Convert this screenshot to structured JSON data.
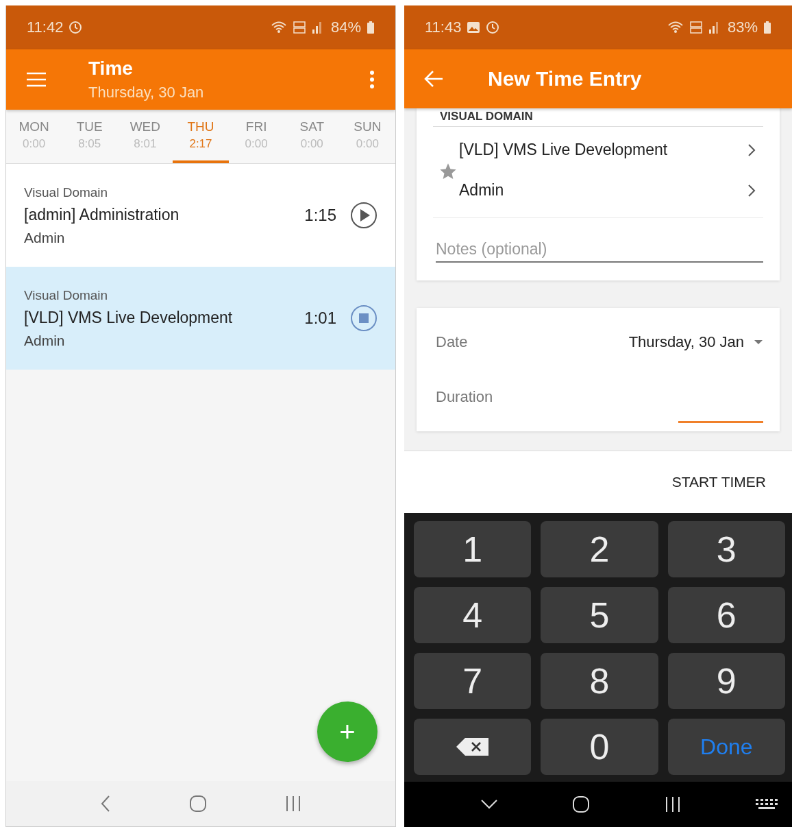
{
  "left": {
    "status_bar": {
      "time": "11:42",
      "battery": "84%"
    },
    "app_bar": {
      "title": "Time",
      "subtitle": "Thursday, 30 Jan"
    },
    "days": [
      {
        "day": "MON",
        "hours": "0:00",
        "selected": false
      },
      {
        "day": "TUE",
        "hours": "8:05",
        "selected": false
      },
      {
        "day": "WED",
        "hours": "8:01",
        "selected": false
      },
      {
        "day": "THU",
        "hours": "2:17",
        "selected": true
      },
      {
        "day": "FRI",
        "hours": "0:00",
        "selected": false
      },
      {
        "day": "SAT",
        "hours": "0:00",
        "selected": false
      },
      {
        "day": "SUN",
        "hours": "0:00",
        "selected": false
      }
    ],
    "entries": [
      {
        "client": "Visual Domain",
        "project": "[admin] Administration",
        "task": "Admin",
        "duration": "1:15",
        "running": false,
        "selected": false
      },
      {
        "client": "Visual Domain",
        "project": "[VLD] VMS Live Development",
        "task": "Admin",
        "duration": "1:01",
        "running": true,
        "selected": true
      }
    ],
    "fab": {
      "label": "+"
    }
  },
  "right": {
    "status_bar": {
      "time": "11:43",
      "battery": "83%"
    },
    "app_bar": {
      "title": "New Time Entry"
    },
    "section_heading": "VISUAL DOMAIN",
    "project": "[VLD] VMS Live Development",
    "favorite": false,
    "task": "Admin",
    "notes": {
      "placeholder": "Notes (optional)"
    },
    "date": {
      "label": "Date",
      "value": "Thursday, 30 Jan"
    },
    "duration": {
      "label": "Duration",
      "focused": true
    },
    "start_timer": "START TIMER",
    "keypad": [
      {
        "kind": "digit",
        "label": "1"
      },
      {
        "kind": "digit",
        "label": "2"
      },
      {
        "kind": "digit",
        "label": "3"
      },
      {
        "kind": "digit",
        "label": "4"
      },
      {
        "kind": "digit",
        "label": "5"
      },
      {
        "kind": "digit",
        "label": "6"
      },
      {
        "kind": "digit",
        "label": "7"
      },
      {
        "kind": "digit",
        "label": "8"
      },
      {
        "kind": "digit",
        "label": "9"
      },
      {
        "kind": "backspace"
      },
      {
        "kind": "digit",
        "label": "0"
      },
      {
        "kind": "done",
        "label": "Done"
      }
    ]
  }
}
